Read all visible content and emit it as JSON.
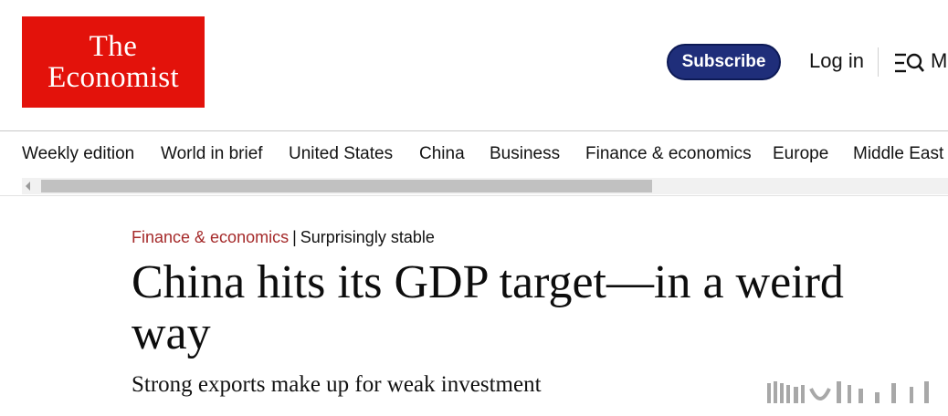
{
  "header": {
    "logo_line1": "The",
    "logo_line2": "Economist",
    "subscribe_label": "Subscribe",
    "login_label": "Log in",
    "menu_label": "M",
    "brand_red": "#e3120b",
    "subscribe_blue": "#1f2e7a"
  },
  "nav": {
    "items": [
      "Weekly edition",
      "World in brief",
      "United States",
      "China",
      "Business",
      "Finance & economics",
      "Europe",
      "Middle East"
    ]
  },
  "article": {
    "section": "Finance & economics",
    "separator": "|",
    "fly_title": "Surprisingly stable",
    "headline": "China hits its GDP target—in a weird way",
    "standfirst": "Strong exports make up for weak investment",
    "section_color": "#a52a2a"
  },
  "icons": {
    "menu": "search-menu-icon",
    "scroll_left": "scroll-left-arrow-icon"
  }
}
